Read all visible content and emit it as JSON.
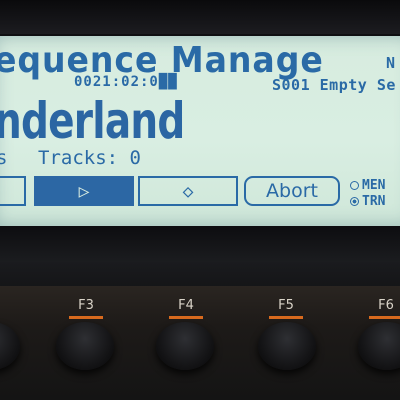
{
  "screen": {
    "title": "equence Manage",
    "title_right": "N",
    "position": "0021:02:0██",
    "sequence_slot": "S001 Empty Se",
    "song_name": "nderland",
    "stats_left": "s",
    "tracks_label": "Tracks: 0"
  },
  "softkeys": {
    "play_glyph": "▷",
    "record_glyph": "◇",
    "abort_label": "Abort"
  },
  "radio_options": [
    {
      "label": "MEN",
      "selected": false
    },
    {
      "label": "TRN",
      "selected": true
    }
  ],
  "function_keys": [
    "F3",
    "F4",
    "F5",
    "F6"
  ],
  "colors": {
    "lcd_background": "#d8ece0",
    "lcd_text": "#2a6aa6",
    "key_accent": "#d86a1e"
  }
}
